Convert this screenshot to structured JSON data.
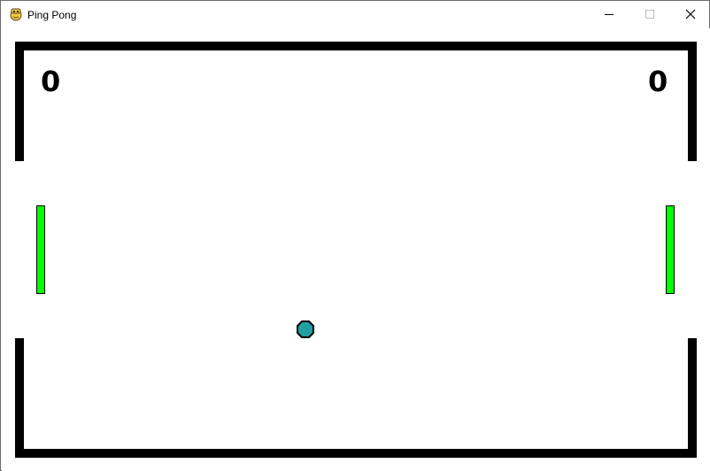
{
  "window": {
    "title": "Ping Pong",
    "app_icon": "pygame-snake-icon",
    "controls": [
      "minimize-icon",
      "maximize-icon",
      "close-icon"
    ]
  },
  "game": {
    "scores": {
      "left": "0",
      "right": "0"
    },
    "paddles": [
      {
        "side": "left",
        "color": "#00ff00"
      },
      {
        "side": "right",
        "color": "#00ff00"
      }
    ],
    "ball": {
      "color": "#20a0a0"
    },
    "wall_color": "#000000",
    "background_color": "#ffffff"
  }
}
